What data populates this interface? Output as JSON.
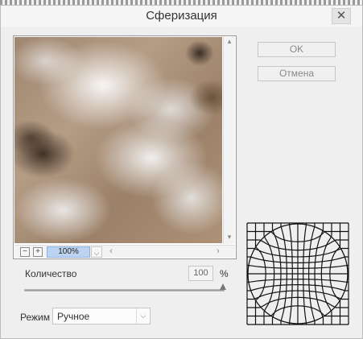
{
  "dialog": {
    "title": "Сферизация",
    "close_glyph": "✕"
  },
  "buttons": {
    "ok": "OK",
    "cancel": "Отмена"
  },
  "preview": {
    "zoom_out": "−",
    "zoom_in": "+",
    "zoom_level": "100%",
    "zoom_dropdown": "⌵",
    "scroll_up": "▴",
    "scroll_down": "▾",
    "scroll_left": "‹",
    "scroll_right": "›"
  },
  "amount": {
    "label": "Количество",
    "value": "100",
    "unit": "%",
    "slider_level": 1.0
  },
  "mode": {
    "label": "Режим",
    "selected": "Ручное",
    "dropdown_glyph": "⌵"
  },
  "icons": {
    "sphere_preview": "spherize-grid-icon"
  },
  "colors": {
    "zoom_highlight": "#bcd4f2",
    "background": "#efefef"
  }
}
